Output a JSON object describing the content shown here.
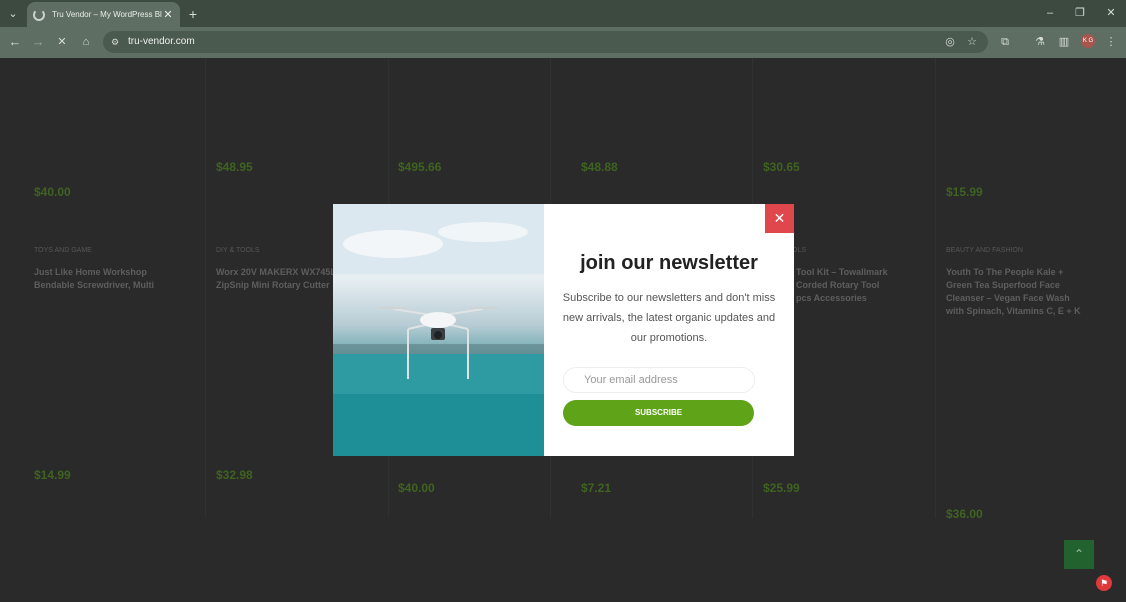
{
  "browser": {
    "tab_title": "Tru Vendor – My WordPress Bl",
    "url": "tru-vendor.com",
    "avatar_initials": "K G"
  },
  "prices_top": [
    "$40.00",
    "$48.95",
    "$495.66",
    "$48.88",
    "$30.65",
    "$15.99"
  ],
  "products": [
    {
      "category": "TOYS AND GAME",
      "name": "Just Like Home Workshop Bendable Screwdriver, Multi"
    },
    {
      "category": "DIY & TOOLS",
      "name": "Worx 20V MAKERX WX745L ZipSnip Mini Rotary Cutter"
    },
    {
      "category": "OLS",
      "name": "Tool Kit – Towallmark Corded Rotary Tool pcs Accessories"
    },
    {
      "category": "BEAUTY AND FASHION",
      "name": "Youth To The People Kale + Green Tea Superfood Face Cleanser – Vegan Face Wash with Spinach, Vitamins C, E + K"
    }
  ],
  "prices_bottom": [
    "$14.99",
    "$32.98",
    "$40.00",
    "$7.21",
    "$25.99",
    "$36.00"
  ],
  "popup": {
    "title": "join our newsletter",
    "description": "Subscribe to our newsletters and don't miss new arrivals, the latest organic updates and our promotions.",
    "email_placeholder": "Your email address",
    "subscribe_label": "SUBSCRIBE",
    "close_label": "✕"
  },
  "scroll_top_label": "⌃",
  "colors": {
    "accent_green": "#5fa318",
    "close_red": "#e0474c"
  }
}
